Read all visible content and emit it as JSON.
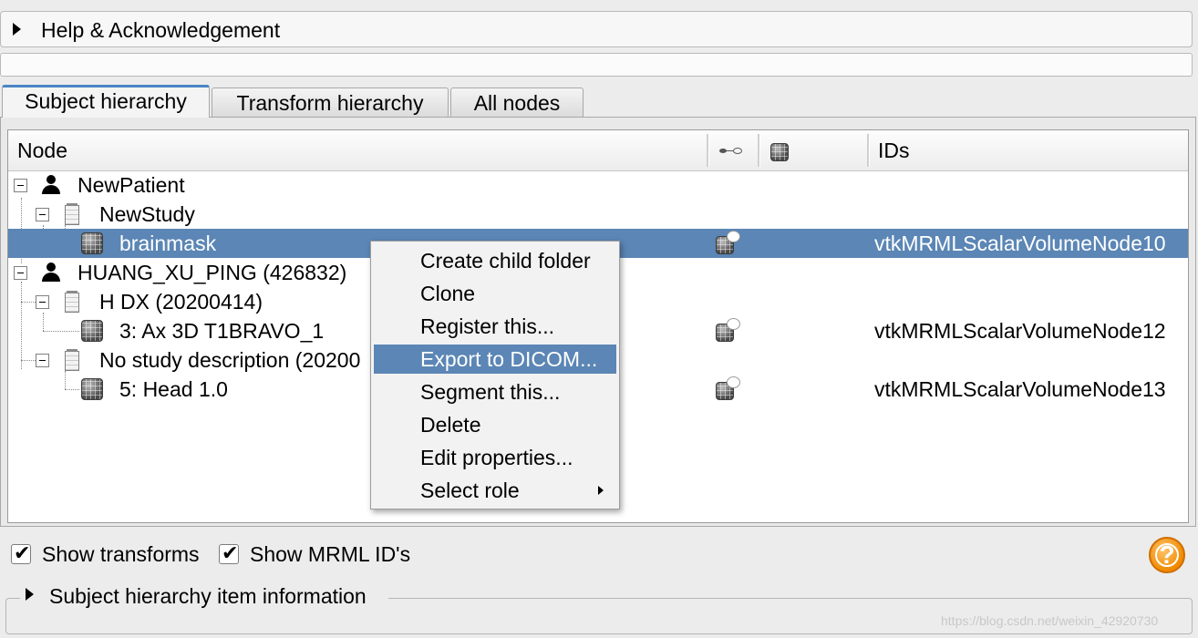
{
  "help_section": {
    "label": "Help & Acknowledgement"
  },
  "tabs": [
    {
      "label": "Subject hierarchy",
      "active": true
    },
    {
      "label": "Transform hierarchy",
      "active": false
    },
    {
      "label": "All nodes",
      "active": false
    }
  ],
  "tree": {
    "columns": {
      "node": "Node",
      "visibility": "eye-icon",
      "transform": "transform-volume-icon",
      "ids": "IDs"
    },
    "rows": [
      {
        "name": "NewPatient",
        "type": "patient",
        "id": ""
      },
      {
        "name": "NewStudy",
        "type": "study",
        "id": ""
      },
      {
        "name": "brainmask",
        "type": "volume",
        "id": "vtkMRMLScalarVolumeNode10",
        "selected": true
      },
      {
        "name": "HUANG_XU_PING (426832)",
        "type": "patient",
        "id": ""
      },
      {
        "name": "H DX (20200414)",
        "type": "study",
        "id": ""
      },
      {
        "name": "3: Ax 3D T1BRAVO_1",
        "type": "volume",
        "id": "vtkMRMLScalarVolumeNode12"
      },
      {
        "name": "No study description (20200",
        "type": "study",
        "id": ""
      },
      {
        "name": "5: Head 1.0",
        "type": "volume",
        "id": "vtkMRMLScalarVolumeNode13"
      }
    ]
  },
  "context_menu": {
    "items": [
      {
        "label": "Create child folder"
      },
      {
        "label": "Clone"
      },
      {
        "label": "Register this..."
      },
      {
        "label": "Export to DICOM...",
        "highlighted": true
      },
      {
        "label": "Segment this..."
      },
      {
        "label": "Delete"
      },
      {
        "label": "Edit properties..."
      },
      {
        "label": "Select role",
        "submenu": true
      }
    ]
  },
  "options": {
    "show_transforms": {
      "label": "Show transforms",
      "checked": true
    },
    "show_mrml_ids": {
      "label": "Show MRML ID's",
      "checked": true
    }
  },
  "help_button": {
    "glyph": "?"
  },
  "info_section": {
    "label": "Subject hierarchy item information"
  },
  "watermark": "https://blog.csdn.net/weixin_42920730",
  "colors": {
    "selection": "#5b86b5",
    "tab_accent": "#4a84c4",
    "help_orange": "#f08a00"
  }
}
